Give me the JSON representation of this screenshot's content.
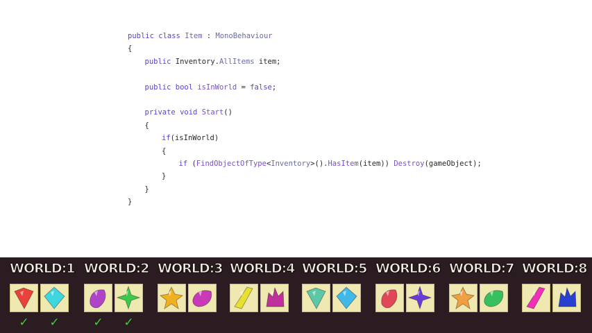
{
  "code": {
    "lines": [
      {
        "indent": 0,
        "tokens": [
          {
            "t": "public class ",
            "c": "kw"
          },
          {
            "t": "Item",
            "c": "ty"
          },
          {
            "t": " : ",
            "c": "pl"
          },
          {
            "t": "MonoBehaviour",
            "c": "ty"
          }
        ]
      },
      {
        "indent": 0,
        "tokens": [
          {
            "t": "{",
            "c": "pl"
          }
        ]
      },
      {
        "indent": 1,
        "tokens": [
          {
            "t": "public ",
            "c": "kw"
          },
          {
            "t": "Inventory.",
            "c": "pl"
          },
          {
            "t": "AllItems",
            "c": "ty"
          },
          {
            "t": " item;",
            "c": "pl"
          }
        ]
      },
      {
        "indent": 0,
        "tokens": []
      },
      {
        "indent": 1,
        "tokens": [
          {
            "t": "public bool ",
            "c": "kw"
          },
          {
            "t": "isInWorld",
            "c": "fn"
          },
          {
            "t": " = ",
            "c": "pl"
          },
          {
            "t": "false",
            "c": "kw"
          },
          {
            "t": ";",
            "c": "pl"
          }
        ]
      },
      {
        "indent": 0,
        "tokens": []
      },
      {
        "indent": 1,
        "tokens": [
          {
            "t": "private void ",
            "c": "kw"
          },
          {
            "t": "Start",
            "c": "fn"
          },
          {
            "t": "()",
            "c": "pl"
          }
        ]
      },
      {
        "indent": 1,
        "tokens": [
          {
            "t": "{",
            "c": "pl"
          }
        ]
      },
      {
        "indent": 2,
        "tokens": [
          {
            "t": "if",
            "c": "kw"
          },
          {
            "t": "(isInWorld)",
            "c": "pl"
          }
        ]
      },
      {
        "indent": 2,
        "tokens": [
          {
            "t": "{",
            "c": "pl"
          }
        ]
      },
      {
        "indent": 3,
        "tokens": [
          {
            "t": "if ",
            "c": "kw"
          },
          {
            "t": "(",
            "c": "pl"
          },
          {
            "t": "FindObjectOfType",
            "c": "fn"
          },
          {
            "t": "<",
            "c": "pl"
          },
          {
            "t": "Inventory",
            "c": "ty"
          },
          {
            "t": ">().",
            "c": "pl"
          },
          {
            "t": "HasItem",
            "c": "fn"
          },
          {
            "t": "(item)) ",
            "c": "pl"
          },
          {
            "t": "Destroy",
            "c": "fn"
          },
          {
            "t": "(gameObject);",
            "c": "pl"
          }
        ]
      },
      {
        "indent": 2,
        "tokens": [
          {
            "t": "}",
            "c": "pl"
          }
        ]
      },
      {
        "indent": 1,
        "tokens": [
          {
            "t": "}",
            "c": "pl"
          }
        ]
      },
      {
        "indent": 0,
        "tokens": [
          {
            "t": "}",
            "c": "pl"
          }
        ]
      }
    ]
  },
  "worlds": [
    {
      "label": "WORLD:1",
      "items": [
        {
          "icon": "red-gem-icon",
          "color": "#e8423a",
          "collected": true
        },
        {
          "icon": "cyan-crystal-icon",
          "color": "#3fd6e0",
          "collected": true
        }
      ]
    },
    {
      "label": "WORLD:2",
      "items": [
        {
          "icon": "purple-shell-icon",
          "color": "#b044c8",
          "collected": true
        },
        {
          "icon": "green-star-gem-icon",
          "color": "#3cc84a",
          "collected": true
        }
      ]
    },
    {
      "label": "WORLD:3",
      "items": [
        {
          "icon": "gold-star-crystal-icon",
          "color": "#f0b020",
          "collected": false
        },
        {
          "icon": "magenta-stone-icon",
          "color": "#c83ab8",
          "collected": false
        }
      ]
    },
    {
      "label": "WORLD:4",
      "items": [
        {
          "icon": "yellow-shard-icon",
          "color": "#e8e030",
          "collected": false
        },
        {
          "icon": "pink-crystal-cluster-icon",
          "color": "#c0309a",
          "collected": false
        }
      ]
    },
    {
      "label": "WORLD:5",
      "items": [
        {
          "icon": "jade-swirl-icon",
          "color": "#5cc8a8",
          "collected": false
        },
        {
          "icon": "blue-crystal-icon",
          "color": "#40b8e8",
          "collected": false
        }
      ]
    },
    {
      "label": "WORLD:6",
      "items": [
        {
          "icon": "red-crystal-flower-icon",
          "color": "#e04858",
          "collected": false
        },
        {
          "icon": "violet-gem-icon",
          "color": "#6a3ad8",
          "collected": false
        }
      ]
    },
    {
      "label": "WORLD:7",
      "items": [
        {
          "icon": "orange-block-icon",
          "color": "#f0a040",
          "collected": false
        },
        {
          "icon": "green-geode-icon",
          "color": "#38c060",
          "collected": false
        }
      ]
    },
    {
      "label": "WORLD:8",
      "items": [
        {
          "icon": "pink-spikes-icon",
          "color": "#f030b8",
          "collected": false
        },
        {
          "icon": "blue-rock-icon",
          "color": "#2840d0",
          "collected": false
        }
      ]
    }
  ],
  "check_glyph": "✓"
}
